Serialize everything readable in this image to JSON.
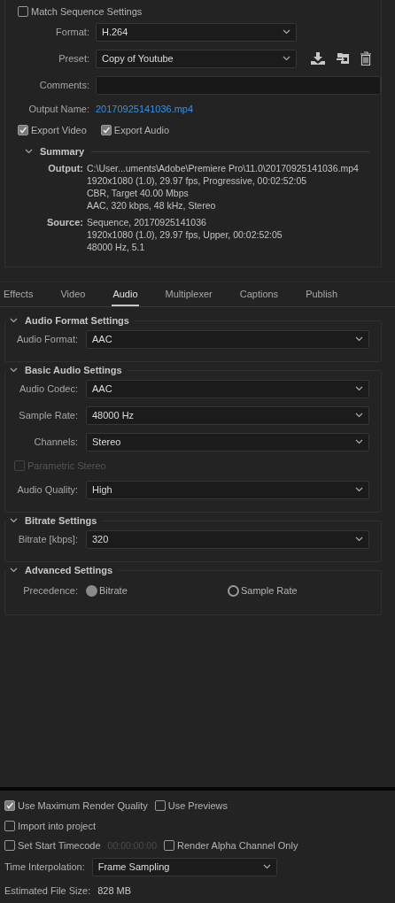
{
  "match_sequence": {
    "label": "Match Sequence Settings",
    "checked": false
  },
  "format": {
    "label": "Format:",
    "value": "H.264"
  },
  "preset": {
    "label": "Preset:",
    "value": "Copy of Youtube"
  },
  "comments": {
    "label": "Comments:"
  },
  "output_name": {
    "label": "Output Name:",
    "value": "20170925141036.mp4"
  },
  "exports": [
    {
      "label": "Export Video",
      "checked": true
    },
    {
      "label": "Export Audio",
      "checked": true
    }
  ],
  "summary": {
    "title": "Summary",
    "expanded": true,
    "groups": [
      {
        "label": "Output:",
        "lines": [
          "C:\\User...uments\\Adobe\\Premiere Pro\\11.0\\20170925141036.mp4",
          "1920x1080 (1.0), 29.97 fps, Progressive, 00:02:52:05",
          "CBR, Target 40.00 Mbps",
          "AAC, 320 kbps, 48 kHz, Stereo"
        ]
      },
      {
        "label": "Source:",
        "lines": [
          "Sequence, 20170925141036",
          "1920x1080 (1.0), 29.97 fps, Upper, 00:02:52:05",
          "48000 Hz, 5.1"
        ]
      }
    ]
  },
  "tabs": [
    {
      "label": "Effects",
      "selected": false
    },
    {
      "label": "Video",
      "selected": false
    },
    {
      "label": "Audio",
      "selected": true
    },
    {
      "label": "Multiplexer",
      "selected": false
    },
    {
      "label": "Captions",
      "selected": false
    },
    {
      "label": "Publish",
      "selected": false
    }
  ],
  "sections": [
    {
      "title": "Audio Format Settings",
      "expanded": true,
      "rows": [
        {
          "kind": "select",
          "label": "Audio Format:",
          "value": "AAC"
        }
      ]
    },
    {
      "title": "Basic Audio Settings",
      "expanded": true,
      "rows": [
        {
          "kind": "select",
          "label": "Audio Codec:",
          "value": "AAC"
        },
        {
          "kind": "select",
          "label": "Sample Rate:",
          "value": "48000 Hz"
        },
        {
          "kind": "select",
          "label": "Channels:",
          "value": "Stereo"
        },
        {
          "kind": "checkbox",
          "label": "Parametric Stereo",
          "checked": false,
          "disabled": true
        },
        {
          "kind": "select",
          "label": "Audio Quality:",
          "value": "High"
        }
      ]
    },
    {
      "title": "Bitrate Settings",
      "expanded": true,
      "rows": [
        {
          "kind": "select",
          "label": "Bitrate [kbps]:",
          "value": "320"
        }
      ]
    },
    {
      "title": "Advanced Settings",
      "expanded": true,
      "rows": [
        {
          "kind": "radio",
          "label": "Precedence:",
          "options": [
            {
              "label": "Bitrate",
              "selected": true
            },
            {
              "label": "Sample Rate",
              "selected": false
            }
          ]
        }
      ]
    }
  ],
  "render_rows": [
    [
      {
        "kind": "checkbox",
        "label": "Use Maximum Render Quality",
        "checked": true
      },
      {
        "kind": "checkbox",
        "label": "Use Previews",
        "checked": false
      }
    ],
    [
      {
        "kind": "checkbox",
        "label": "Import into project",
        "checked": false
      }
    ],
    [
      {
        "kind": "checkbox",
        "label": "Set Start Timecode",
        "checked": false
      },
      {
        "kind": "timecode",
        "value": "00:00:00:00",
        "disabled": true
      },
      {
        "kind": "checkbox",
        "label": "Render Alpha Channel Only",
        "checked": false
      }
    ]
  ],
  "time_interpolation": {
    "label": "Time Interpolation:",
    "value": "Frame Sampling"
  },
  "estimated_size": {
    "label": "Estimated File Size:",
    "value": "828 MB"
  }
}
